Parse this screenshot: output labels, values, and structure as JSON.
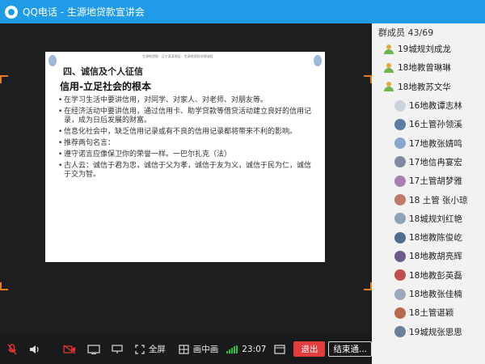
{
  "window": {
    "title": "QQ电话 - 生源地贷款宣讲会"
  },
  "slide": {
    "header_tiny": "生源地贷款  ·  辽宁某某地区  ·  生源地贷款办理流程",
    "heading": "四、诚信及个人征信",
    "subheading": "信用-立足社会的根本",
    "bullets": [
      "在学习生活中要讲信用，对同学、对家人、对老师、对朋友等。",
      "在经济活动中要讲信用，通过信用卡、助学贷款等借贷活动建立良好的信用记录，成为日后发展的财富。",
      "信息化社会中，缺乏信用记录或有不良的信用记录都将带来不利的影响。",
      "推荐两句名言：",
      "遵守诺言应像保卫你的荣誉一样。一巴尔扎克（法）",
      "古人云：诚信于君为忠，诚信于父为孝，诚信于友为义，诚信于民为仁，诚信于交为智。"
    ]
  },
  "sidebar": {
    "header": "群成员 43/69",
    "members": [
      {
        "name": "19城规刘成龙",
        "avatar": "person",
        "color": "#6fb44c"
      },
      {
        "name": "18地教曾琳琳",
        "avatar": "person",
        "color": "#6fb44c"
      },
      {
        "name": "18地教苏文华",
        "avatar": "person",
        "color": "#6fb44c"
      },
      {
        "name": "16地教谭志林",
        "avatar": "photo",
        "color": "#c9d3e0"
      },
      {
        "name": "16土管孙领溪",
        "avatar": "photo",
        "color": "#5a7ca3"
      },
      {
        "name": "17地教张婧鸣",
        "avatar": "photo",
        "color": "#8aa6cf"
      },
      {
        "name": "17地信冉宴宏",
        "avatar": "photo",
        "color": "#7d8aa0"
      },
      {
        "name": "17土管胡梦雅",
        "avatar": "photo",
        "color": "#a87fb0"
      },
      {
        "name": "18 土管 张小琼",
        "avatar": "photo",
        "color": "#c07a6a"
      },
      {
        "name": "18城规刘红艳",
        "avatar": "photo",
        "color": "#8fa1b6"
      },
      {
        "name": "18地教陈俊屹",
        "avatar": "photo",
        "color": "#4e6e8e"
      },
      {
        "name": "18地教胡亮辉",
        "avatar": "photo",
        "color": "#6b5a8a"
      },
      {
        "name": "18地教彭英磊",
        "avatar": "photo",
        "color": "#c0504d"
      },
      {
        "name": "18地教张佳楠",
        "avatar": "photo",
        "color": "#9aa9b8"
      },
      {
        "name": "18土管谌颖",
        "avatar": "photo",
        "color": "#b76a4d"
      },
      {
        "name": "19城规张思思",
        "avatar": "photo",
        "color": "#6e7f99"
      }
    ]
  },
  "toolbar": {
    "fullscreen_label": "全屏",
    "pip_label": "画中画",
    "time": "23:07",
    "exit_label": "退出",
    "end_label": "结束通..."
  },
  "colors": {
    "titlebar": "#1f9be8",
    "exit_button": "#e23d3d",
    "signal": "#2bc23f",
    "frame_corner": "#e77b1e"
  }
}
